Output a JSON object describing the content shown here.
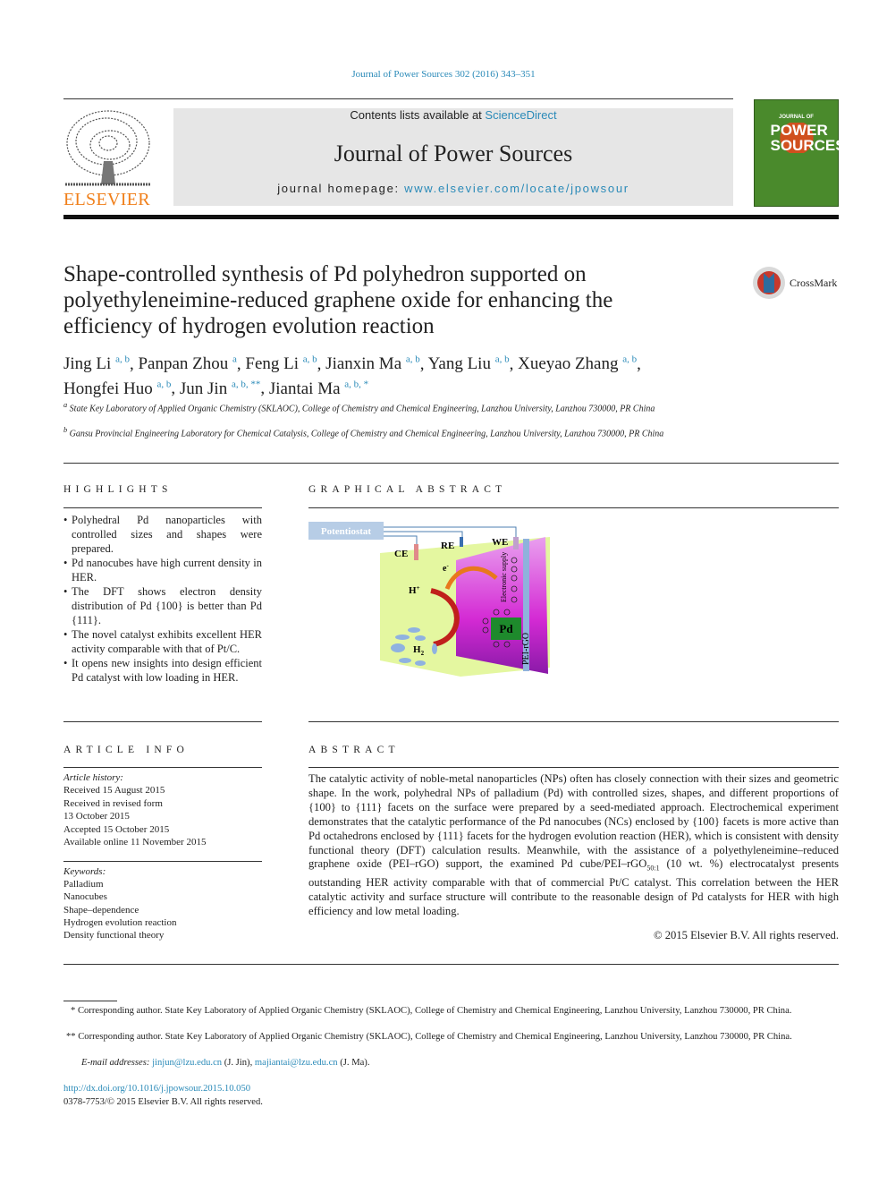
{
  "header": {
    "journal_ref": "Journal of Power Sources 302 (2016) 343–351",
    "contents_prefix": "Contents lists available at ",
    "sciencedirect": "ScienceDirect",
    "journal_title": "Journal of Power Sources",
    "homepage_prefix": "journal homepage: ",
    "homepage_url": "www.elsevier.com/locate/jpowsour",
    "publisher": "ELSEVIER",
    "cover_title_top": "JOURNAL OF",
    "cover_title_main": "POWER SOURCES",
    "accent": "#2a8ab8",
    "publisher_color": "#f07f1a",
    "cover_color": "#4a8a2c"
  },
  "article": {
    "title": "Shape-controlled synthesis of Pd polyhedron supported on polyethyleneimine-reduced graphene oxide for enhancing the efficiency of hydrogen evolution reaction",
    "crossmark": "CrossMark",
    "authors": [
      {
        "name": "Jing Li",
        "sup": "a, b"
      },
      {
        "name": "Panpan Zhou",
        "sup": "a"
      },
      {
        "name": "Feng Li",
        "sup": "a, b"
      },
      {
        "name": "Jianxin Ma",
        "sup": "a, b"
      },
      {
        "name": "Yang Liu",
        "sup": "a, b"
      },
      {
        "name": "Xueyao Zhang",
        "sup": "a, b"
      },
      {
        "name": "Hongfei Huo",
        "sup": "a, b"
      },
      {
        "name": "Jun Jin",
        "sup": "a, b, **"
      },
      {
        "name": "Jiantai Ma",
        "sup": "a, b, *"
      }
    ],
    "affiliations": [
      {
        "mark": "a",
        "text": "State Key Laboratory of Applied Organic Chemistry (SKLAOC), College of Chemistry and Chemical Engineering, Lanzhou University, Lanzhou 730000, PR China"
      },
      {
        "mark": "b",
        "text": "Gansu Provincial Engineering Laboratory for Chemical Catalysis, College of Chemistry and Chemical Engineering, Lanzhou University, Lanzhou 730000, PR China"
      }
    ]
  },
  "highlights": {
    "heading": "HIGHLIGHTS",
    "items": [
      "Polyhedral Pd nanoparticles with controlled sizes and shapes were prepared.",
      "Pd nanocubes have high current density in HER.",
      "The DFT shows electron density distribution of Pd {100} is better than Pd {111}.",
      "The novel catalyst exhibits excellent HER activity comparable with that of Pt/C.",
      "It opens new insights into design efficient Pd catalyst with low loading in HER."
    ]
  },
  "graphical_abstract": {
    "heading": "GRAPHICAL ABSTRACT",
    "labels": {
      "potentiostat": "Potentiostat",
      "ce": "CE",
      "re": "RE",
      "we": "WE",
      "electron": "e",
      "hplus": "H",
      "h2": "H",
      "electronic_supply": "Electronic supply",
      "pd": "Pd",
      "support": "PEI-rGO"
    }
  },
  "article_info": {
    "heading": "ARTICLE INFO",
    "history_label": "Article history:",
    "history": [
      "Received 15 August 2015",
      "Received in revised form",
      "13 October 2015",
      "Accepted 15 October 2015",
      "Available online 11 November 2015"
    ],
    "keywords_label": "Keywords:",
    "keywords": [
      "Palladium",
      "Nanocubes",
      "Shape–dependence",
      "Hydrogen evolution reaction",
      "Density functional theory"
    ]
  },
  "abstract": {
    "heading": "ABSTRACT",
    "text_1": "The catalytic activity of noble-metal nanoparticles (NPs) often has closely connection with their sizes and geometric shape. In the work, polyhedral NPs of palladium (Pd) with controlled sizes, shapes, and different proportions of {100} to {111} facets on the surface were prepared by a seed-mediated approach. Electrochemical experiment demonstrates that the catalytic performance of the Pd nanocubes (NCs) enclosed by {100} facets is more active than Pd octahedrons enclosed by {111} facets for the hydrogen evolution reaction (HER), which is consistent with density functional theory (DFT) calculation results. Meanwhile, with the assistance of a polyethyleneimine–reduced graphene oxide (PEI–rGO) support, the examined Pd cube/PEI–rGO",
    "subscript": "50:1",
    "text_2": " (10 wt. %) electrocatalyst presents outstanding HER activity comparable with that of commercial Pt/C catalyst. This correlation between the HER catalytic activity and surface structure will contribute to the reasonable design of Pd catalysts for HER with high efficiency and low metal loading.",
    "copyright": "© 2015 Elsevier B.V. All rights reserved."
  },
  "footnotes": {
    "fn1": "* Corresponding author. State Key Laboratory of Applied Organic Chemistry (SKLAOC), College of Chemistry and Chemical Engineering, Lanzhou University, Lanzhou 730000, PR China.",
    "fn2": "** Corresponding author. State Key Laboratory of Applied Organic Chemistry (SKLAOC), College of Chemistry and Chemical Engineering, Lanzhou University, Lanzhou 730000, PR China.",
    "email_label": "E-mail addresses:",
    "email1": "jinjun@lzu.edu.cn",
    "email1_owner": " (J. Jin), ",
    "email2": "majiantai@lzu.edu.cn",
    "email2_owner": " (J. Ma).",
    "doi": "http://dx.doi.org/10.1016/j.jpowsour.2015.10.050",
    "issn": "0378-7753/© 2015 Elsevier B.V. All rights reserved."
  }
}
